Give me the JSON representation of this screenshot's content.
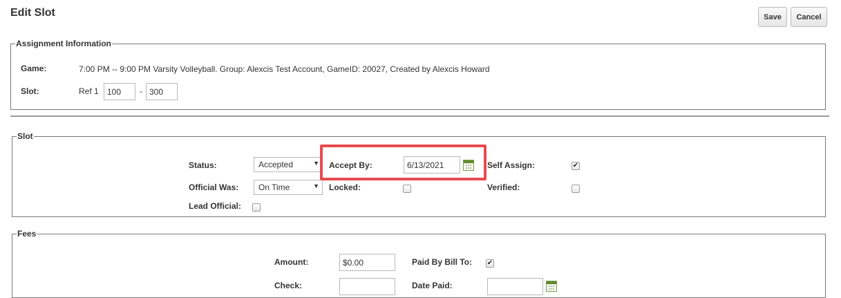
{
  "page": {
    "title": "Edit Slot",
    "save_label": "Save",
    "cancel_label": "Cancel"
  },
  "assignment": {
    "legend": "Assignment Information",
    "game_label": "Game:",
    "game_value": "7:00 PM -- 9:00 PM Varsity Volleyball. Group: Alexcis Test Account, GameID: 20027, Created by Alexcis Howard",
    "slot_label": "Slot:",
    "slot_prefix": "Ref 1",
    "slot_from": "100",
    "slot_sep": "-",
    "slot_to": "300"
  },
  "slot": {
    "legend": "Slot",
    "status_label": "Status:",
    "status_value": "Accepted",
    "accept_by_label": "Accept By:",
    "accept_by_value": "6/13/2021",
    "self_assign_label": "Self Assign:",
    "self_assign_checked": true,
    "official_was_label": "Official Was:",
    "official_was_value": "On Time",
    "locked_label": "Locked:",
    "locked_checked": false,
    "verified_label": "Verified:",
    "verified_checked": false,
    "lead_official_label": "Lead Official:",
    "lead_official_checked": false
  },
  "fees": {
    "legend": "Fees",
    "amount_label": "Amount:",
    "amount_value": "$0.00",
    "paid_by_bill_to_label": "Paid By Bill To:",
    "paid_by_bill_to_checked": true,
    "check_label": "Check:",
    "check_value": "",
    "date_paid_label": "Date Paid:",
    "date_paid_value": ""
  },
  "icons": {
    "calendar": "calendar-icon",
    "dropdown": "chevron-down-icon"
  },
  "colors": {
    "highlight": "#e84a4f"
  }
}
